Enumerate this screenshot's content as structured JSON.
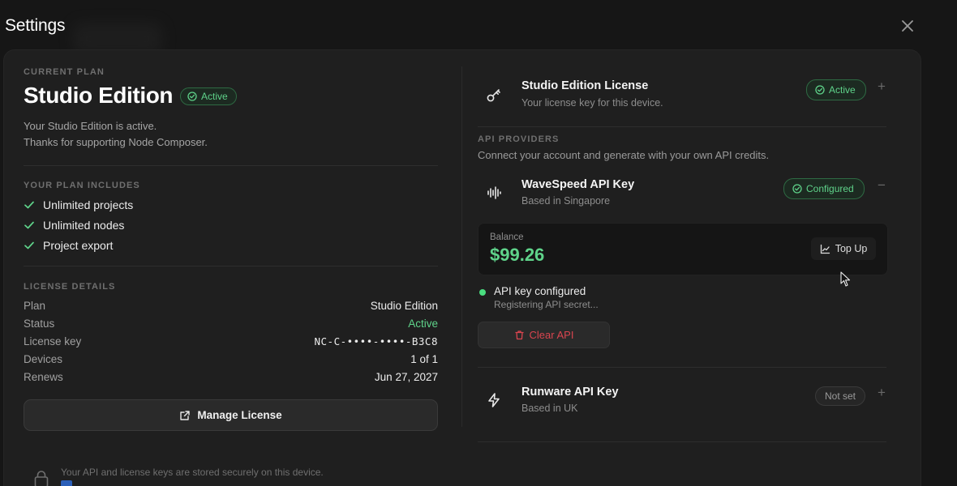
{
  "header": {
    "title": "Settings"
  },
  "plan": {
    "section_label": "CURRENT PLAN",
    "name": "Studio Edition",
    "status_badge": "Active",
    "desc_line1": "Your Studio Edition is active.",
    "desc_line2": "Thanks for supporting Node Composer."
  },
  "includes": {
    "section_label": "YOUR PLAN INCLUDES",
    "items": [
      "Unlimited projects",
      "Unlimited nodes",
      "Project export"
    ]
  },
  "license_details": {
    "section_label": "LICENSE DETAILS",
    "rows": [
      {
        "key": "Plan",
        "value": "Studio Edition"
      },
      {
        "key": "Status",
        "value": "Active"
      },
      {
        "key": "License key",
        "value": "NC-C-••••-••••-B3C8"
      },
      {
        "key": "Devices",
        "value": "1 of 1"
      },
      {
        "key": "Renews",
        "value": "Jun 27, 2027"
      }
    ],
    "manage_button": "Manage License"
  },
  "license_card": {
    "title": "Studio Edition License",
    "subtitle": "Your license key for this device.",
    "badge": "Active",
    "toggle": "+"
  },
  "api_providers": {
    "section_label": "API PROVIDERS",
    "description": "Connect your account and generate with your own API credits.",
    "wavespeed": {
      "title": "WaveSpeed API Key",
      "subtitle": "Based in Singapore",
      "badge": "Configured",
      "toggle": "−",
      "balance_label": "Balance",
      "balance_value": "$99.26",
      "topup_label": "Top Up",
      "status_title": "API key configured",
      "status_sub": "Registering API secret...",
      "clear_label": "Clear API"
    },
    "runware": {
      "title": "Runware API Key",
      "subtitle": "Based in UK",
      "badge": "Not set",
      "toggle": "+"
    }
  },
  "footer": {
    "security_note": "Your API and license keys are stored securely on this device."
  },
  "colors": {
    "accent_green": "#5fd38a",
    "danger": "#d9454f",
    "panel": "#1f1f1f"
  }
}
